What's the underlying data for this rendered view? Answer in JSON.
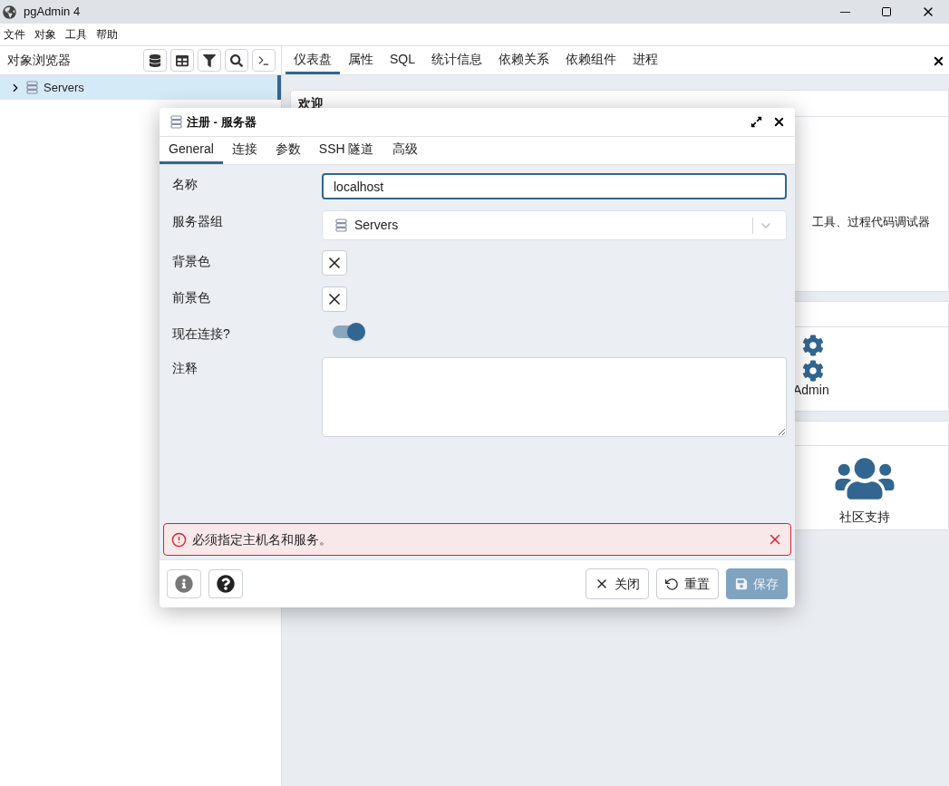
{
  "window": {
    "title": "pgAdmin 4"
  },
  "menu": [
    "文件",
    "对象",
    "工具",
    "帮助"
  ],
  "browser": {
    "title": "对象浏览器",
    "tree": [
      {
        "label": "Servers",
        "expanded": false,
        "selected": true
      }
    ]
  },
  "tabs": [
    {
      "label": "仪表盘",
      "selected": true
    },
    {
      "label": "属性",
      "selected": false
    },
    {
      "label": "SQL",
      "selected": false
    },
    {
      "label": "统计信息",
      "selected": false
    },
    {
      "label": "依赖关系",
      "selected": false
    },
    {
      "label": "依赖组件",
      "selected": false
    },
    {
      "label": "进程",
      "selected": false
    }
  ],
  "dashboard": {
    "welcome_title": "欢迎",
    "welcome_text": "工具、过程代码调试器",
    "admin_label": "Admin",
    "community_label": "社区支持"
  },
  "dialog": {
    "title": "注册 - 服务器",
    "tabs": [
      {
        "label": "General",
        "selected": true
      },
      {
        "label": "连接",
        "selected": false
      },
      {
        "label": "参数",
        "selected": false
      },
      {
        "label": "SSH 隧道",
        "selected": false
      },
      {
        "label": "高级",
        "selected": false
      }
    ],
    "fields": [
      {
        "kind": "text",
        "label": "名称",
        "value": "localhost",
        "focused": true
      },
      {
        "kind": "select",
        "label": "服务器组",
        "value": "Servers"
      },
      {
        "kind": "color",
        "label": "背景色"
      },
      {
        "kind": "color",
        "label": "前景色"
      },
      {
        "kind": "switch",
        "label": "现在连接?",
        "on": true
      },
      {
        "kind": "textarea",
        "label": "注释"
      }
    ],
    "error": "必须指定主机名和服务。",
    "buttons": [
      {
        "kind": "close",
        "label": "关闭",
        "disabled": false
      },
      {
        "kind": "reset",
        "label": "重置",
        "disabled": false
      },
      {
        "kind": "save",
        "label": "保存",
        "disabled": true
      }
    ]
  }
}
